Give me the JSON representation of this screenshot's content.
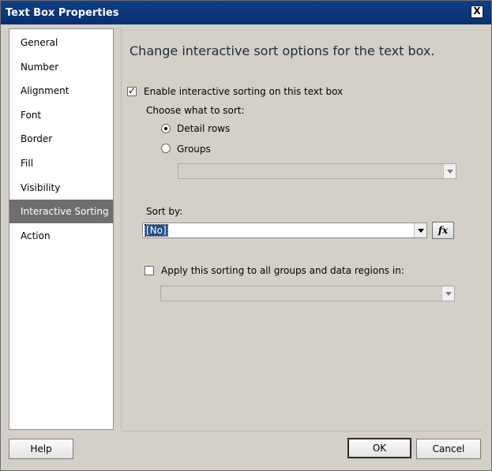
{
  "window": {
    "title": "Text Box Properties",
    "close_glyph": "X"
  },
  "nav": {
    "items": [
      {
        "label": "General"
      },
      {
        "label": "Number"
      },
      {
        "label": "Alignment"
      },
      {
        "label": "Font"
      },
      {
        "label": "Border"
      },
      {
        "label": "Fill"
      },
      {
        "label": "Visibility"
      },
      {
        "label": "Interactive Sorting"
      },
      {
        "label": "Action"
      }
    ],
    "active_index": 7
  },
  "panel": {
    "heading": "Change interactive sort options for the text box.",
    "enable_sorting": {
      "label": "Enable interactive sorting on this text box",
      "checked": true
    },
    "choose_label": "Choose what to sort:",
    "detail_rows": {
      "label": "Detail rows",
      "selected": true
    },
    "groups": {
      "label": "Groups",
      "selected": false
    },
    "groups_combo_value": "",
    "sort_by_label": "Sort by:",
    "sort_by_value": "[No]",
    "fx_label": "fx",
    "apply_all": {
      "label": "Apply this sorting to all groups and data regions in:",
      "checked": false
    },
    "apply_combo_value": ""
  },
  "buttons": {
    "help": "Help",
    "ok": "OK",
    "cancel": "Cancel"
  }
}
